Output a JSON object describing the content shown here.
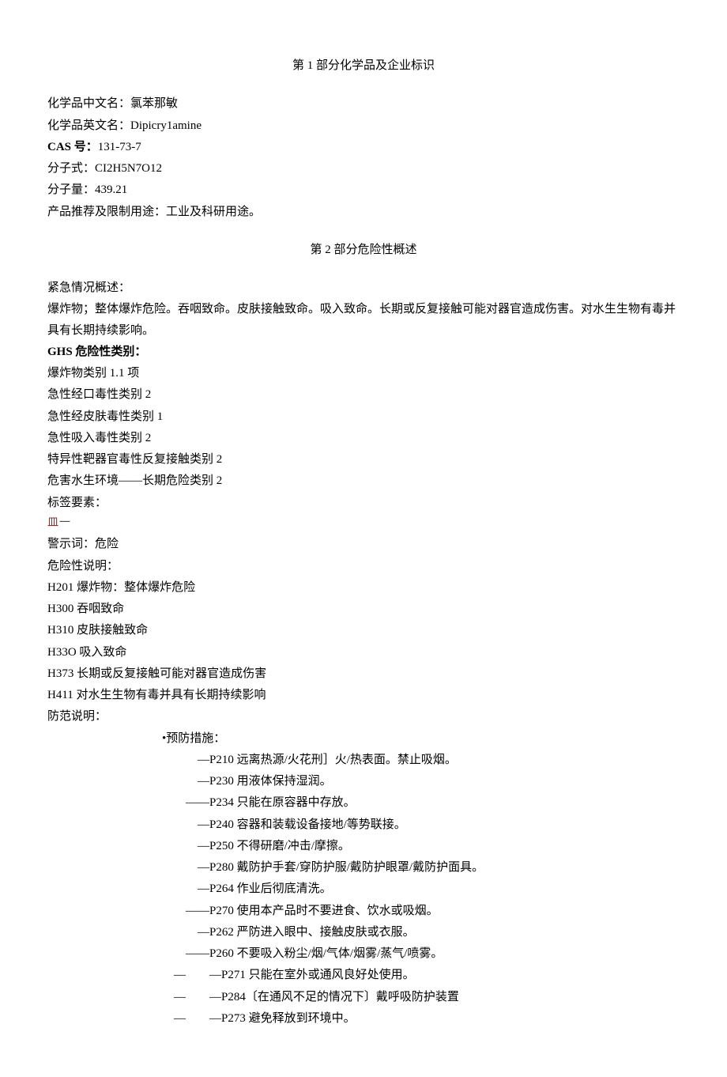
{
  "section1": {
    "title": "第 1 部分化学品及企业标识",
    "fields": {
      "name_cn_label": "化学品中文名：",
      "name_cn_value": "氯苯那敏",
      "name_en_label": "化学品英文名：",
      "name_en_value": "Dipicry1amine",
      "cas_label": "CAS 号：",
      "cas_value": "131-73-7",
      "formula_label": "分子式：",
      "formula_value": "CI2H5N7O12",
      "mw_label": "分子量：",
      "mw_value": "439.21",
      "use_label": "产品推荐及限制用途：",
      "use_value": "工业及科研用途。"
    }
  },
  "section2": {
    "title": "第 2 部分危险性概述",
    "emergency_label": "紧急情况概述：",
    "emergency_text": "爆炸物；整体爆炸危险。吞咽致命。皮肤接触致命。吸入致命。长期或反复接触可能对器官造成伤害。对水生生物有毒并具有长期持续影响。",
    "ghs_label": "GHS 危险性类别：",
    "ghs_cats": [
      "爆炸物类别 1.1 项",
      "急性经口毒性类别 2",
      "急性经皮肤毒性类别 1",
      "急性吸入毒性类别 2",
      "特异性靶器官毒性反复接触类别 2",
      "危害水生环境——长期危险类别 2"
    ],
    "label_elements": "标签要素：",
    "symbol": "皿一",
    "signal_word_label": "警示词：",
    "signal_word_value": "危险",
    "hazard_label": "危险性说明：",
    "hazards": [
      "H201 爆炸物：整体爆炸危险",
      "H300 吞咽致命",
      "H310 皮肤接触致命",
      "H33O 吸入致命",
      "H373 长期或反复接触可能对器官造成伤害",
      "H411 对水生生物有毒并具有长期持续影响"
    ],
    "precaution_label": "防范说明：",
    "prevention_label": "•预防措施：",
    "preventions": [
      {
        "prefix": "—",
        "text": "P210 远离热源/火花刑］火/热表面。禁止吸烟。"
      },
      {
        "prefix": "—",
        "text": "P230 用液体保持湿润。"
      },
      {
        "prefix": "——",
        "text": "P234 只能在原容器中存放。"
      },
      {
        "prefix": "—",
        "text": "P240 容器和装载设备接地/等势联接。"
      },
      {
        "prefix": "—",
        "text": "P250 不得研磨/冲击/摩擦。"
      },
      {
        "prefix": "—",
        "text": "P280 戴防护手套/穿防护服/戴防护眼罩/戴防护面具。"
      },
      {
        "prefix": "—",
        "text": "P264 作业后彻底清洗。"
      },
      {
        "prefix": "——",
        "text": "P270 使用本产品时不要进食、饮水或吸烟。"
      },
      {
        "prefix": "—",
        "text": "P262 严防进入眼中、接触皮肤或衣服。"
      },
      {
        "prefix": "——",
        "text": "P260 不要吸入粉尘/烟/气体/烟雾/蒸气/喷雾。"
      },
      {
        "prefix": "—　　—",
        "text": "P271 只能在室外或通风良好处使用。"
      },
      {
        "prefix": "—　　—",
        "text": "P284〔在通风不足的情况下〕戴呼吸防护装置"
      },
      {
        "prefix": "—　　—",
        "text": "P273 避免释放到环境中。"
      }
    ]
  }
}
